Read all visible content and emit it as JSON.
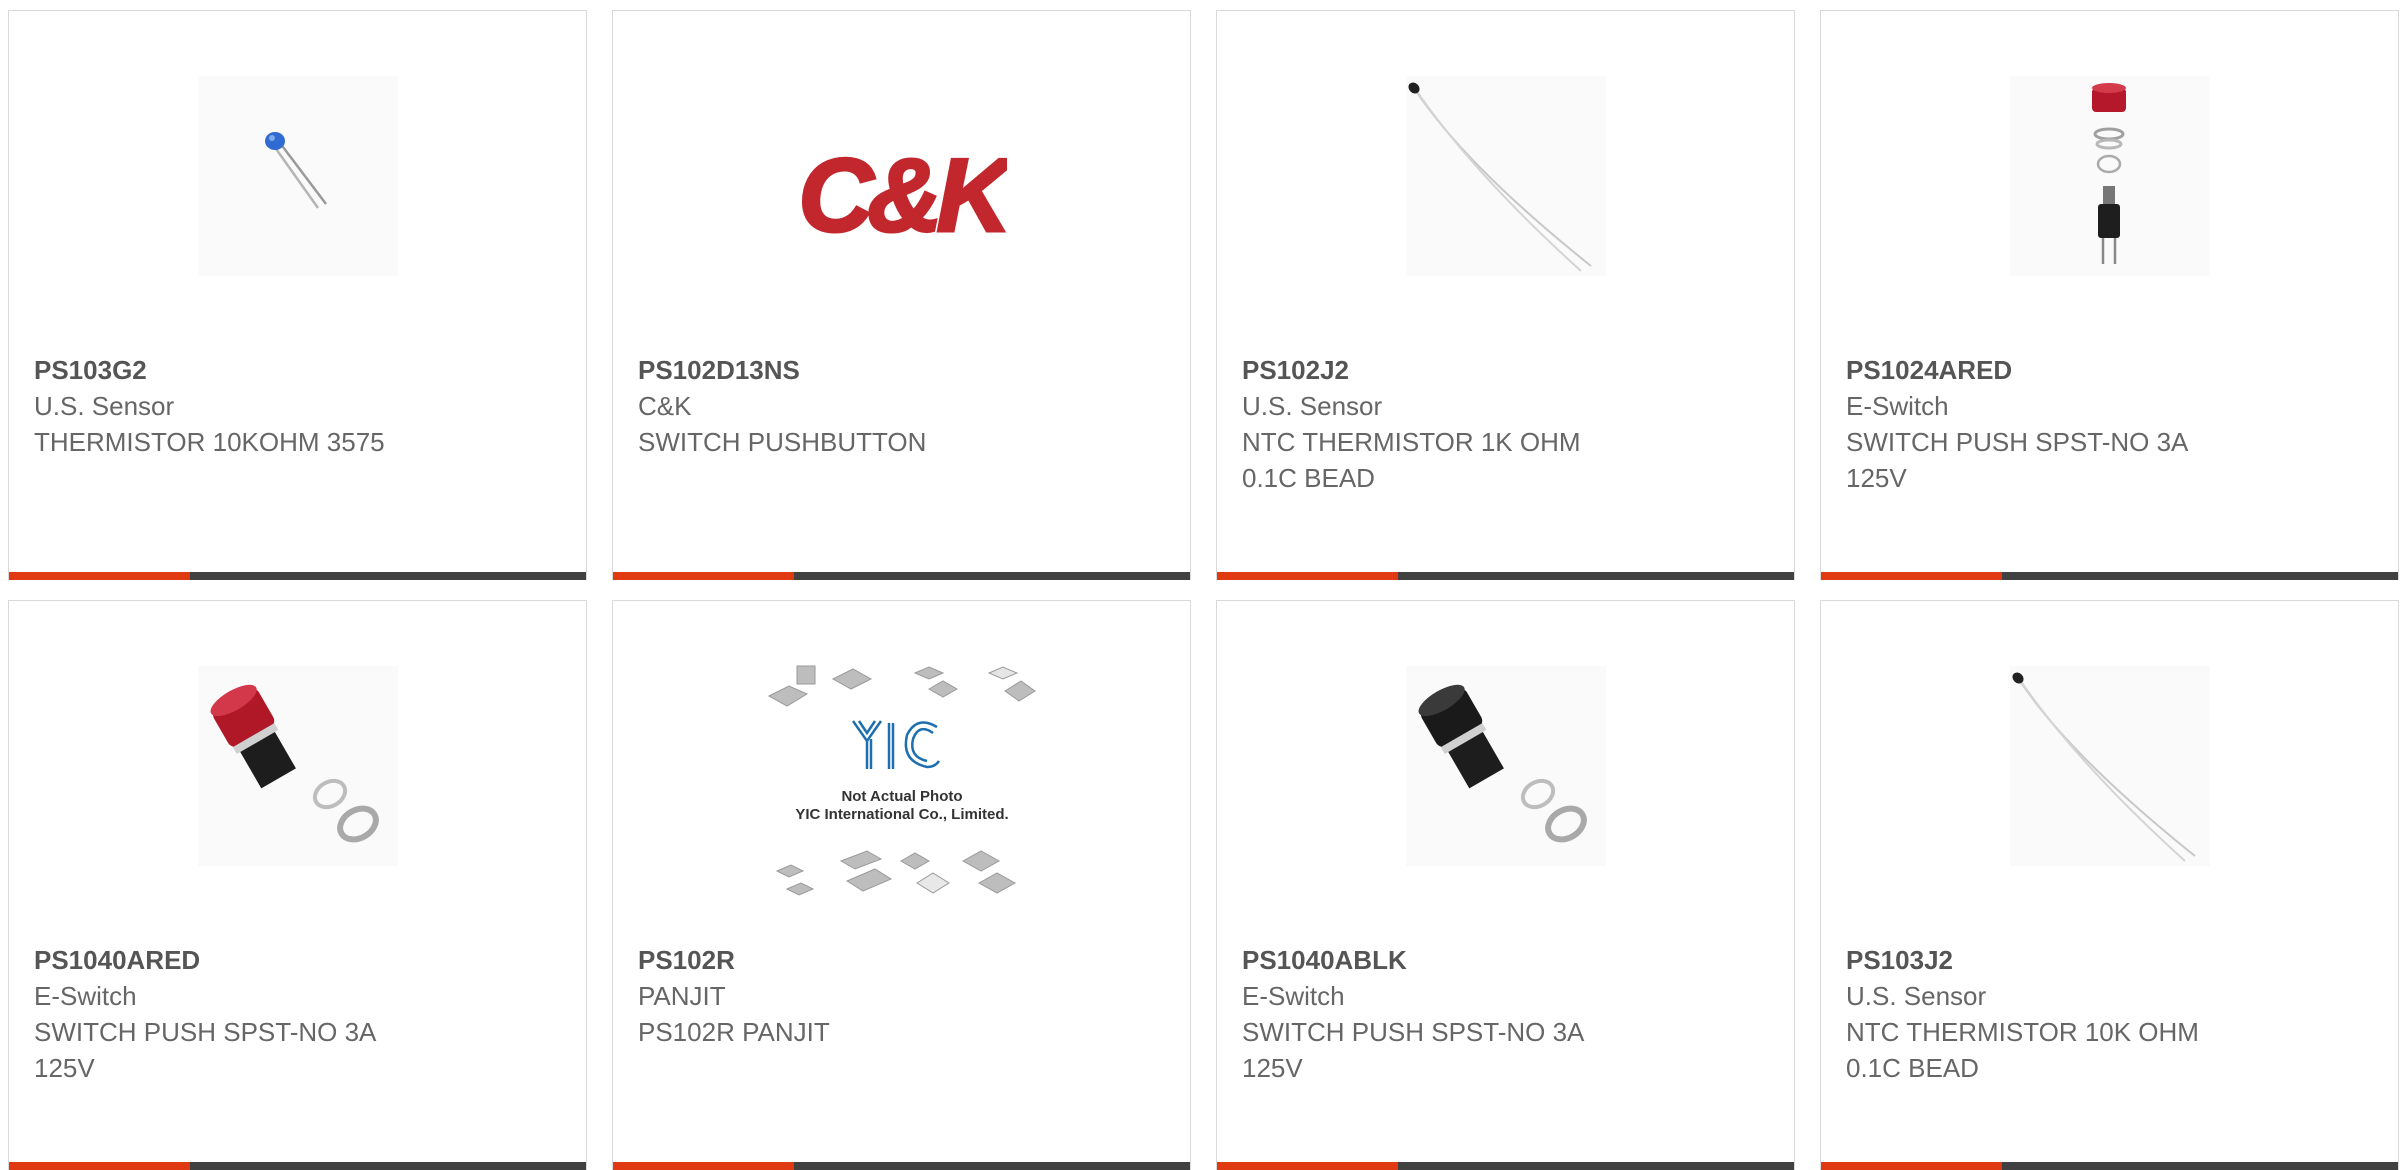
{
  "colors": {
    "accent": "#e03a12",
    "bar_dark": "#414141",
    "border": "#d9d9d9",
    "text": "#555555"
  },
  "products": [
    {
      "part": "PS103G2",
      "manufacturer": "U.S. Sensor",
      "description": "THERMISTOR 10KOHM 3575",
      "image": "blue-bead-thermistor"
    },
    {
      "part": "PS102D13NS",
      "manufacturer": "C&K",
      "description": "SWITCH PUSHBUTTON",
      "image": "ck-logo",
      "logo_text": "C&K"
    },
    {
      "part": "PS102J2",
      "manufacturer": "U.S. Sensor",
      "description": "NTC THERMISTOR 1K OHM\n0.1C BEAD",
      "image": "lead-wire-thermistor"
    },
    {
      "part": "PS1024ARED",
      "manufacturer": "E-Switch",
      "description": "SWITCH PUSH SPST-NO 3A\n125V",
      "image": "exploded-pushbutton-red"
    },
    {
      "part": "PS1040ARED",
      "manufacturer": "E-Switch",
      "description": "SWITCH PUSH SPST-NO 3A\n125V",
      "image": "red-pushbutton"
    },
    {
      "part": "PS102R",
      "manufacturer": "PANJIT",
      "description": "PS102R PANJIT",
      "image": "not-actual-photo",
      "placeholder_line1": "Not Actual Photo",
      "placeholder_line2": "YIC International Co., Limited."
    },
    {
      "part": "PS1040ABLK",
      "manufacturer": "E-Switch",
      "description": "SWITCH PUSH SPST-NO 3A\n125V",
      "image": "black-pushbutton"
    },
    {
      "part": "PS103J2",
      "manufacturer": "U.S. Sensor",
      "description": "NTC THERMISTOR 10K OHM\n0.1C BEAD",
      "image": "lead-wire-thermistor"
    }
  ]
}
